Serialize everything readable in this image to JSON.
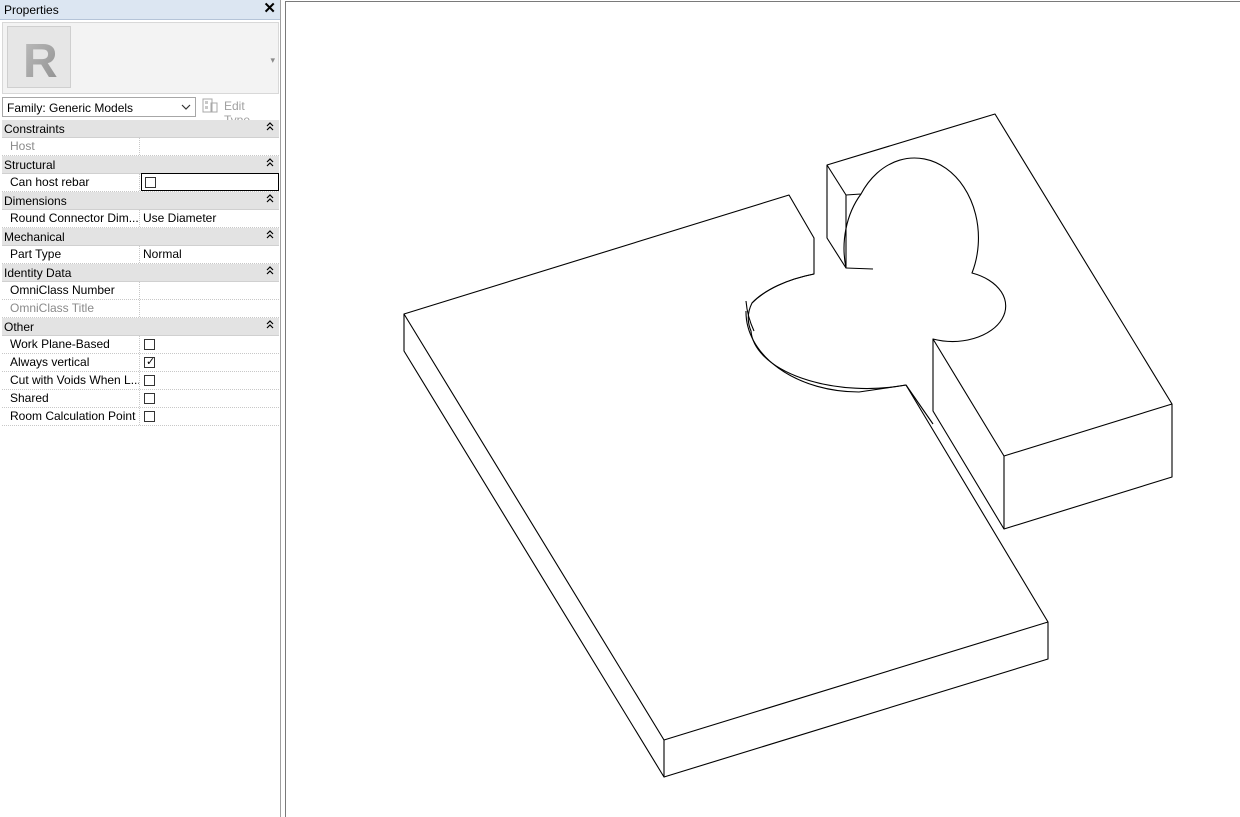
{
  "panel": {
    "title": "Properties",
    "close_glyph": "✕"
  },
  "preview": {
    "logo_letter": "R",
    "dropdown_glyph": "▾"
  },
  "type_selector": {
    "value": "Family: Generic Models",
    "chevron": "⌵"
  },
  "edit_type": {
    "label": "Edit Type"
  },
  "groups": [
    {
      "label": "Constraints",
      "toggle": "⌃"
    },
    {
      "label": "Structural",
      "toggle": "⌃"
    },
    {
      "label": "Dimensions",
      "toggle": "⌃"
    },
    {
      "label": "Mechanical",
      "toggle": "⌃"
    },
    {
      "label": "Identity Data",
      "toggle": "⌃"
    },
    {
      "label": "Other",
      "toggle": "⌃"
    }
  ],
  "rows": {
    "host": {
      "name": "Host",
      "value": ""
    },
    "can_host_rebar": {
      "name": "Can host rebar",
      "checked": false
    },
    "round_connector": {
      "name": "Round Connector Dim...",
      "value": "Use Diameter"
    },
    "part_type": {
      "name": "Part Type",
      "value": "Normal"
    },
    "omniclass_number": {
      "name": "OmniClass Number",
      "value": ""
    },
    "omniclass_title": {
      "name": "OmniClass Title",
      "value": ""
    },
    "work_plane_based": {
      "name": "Work Plane-Based",
      "checked": false
    },
    "always_vertical": {
      "name": "Always vertical",
      "checked": true
    },
    "cut_with_voids": {
      "name": "Cut with Voids When L...",
      "checked": false
    },
    "shared": {
      "name": "Shared",
      "checked": false
    },
    "room_calc_point": {
      "name": "Room Calculation Point",
      "checked": false
    }
  },
  "checkmark_glyph": "✓",
  "icons": {
    "logo": "revit-logo-icon",
    "close": "close-icon",
    "edit_type": "edit-type-icon"
  },
  "colors": {
    "titlebar": "#dce6f2",
    "group_header": "#e3e3e3",
    "model_line": "#000000"
  }
}
